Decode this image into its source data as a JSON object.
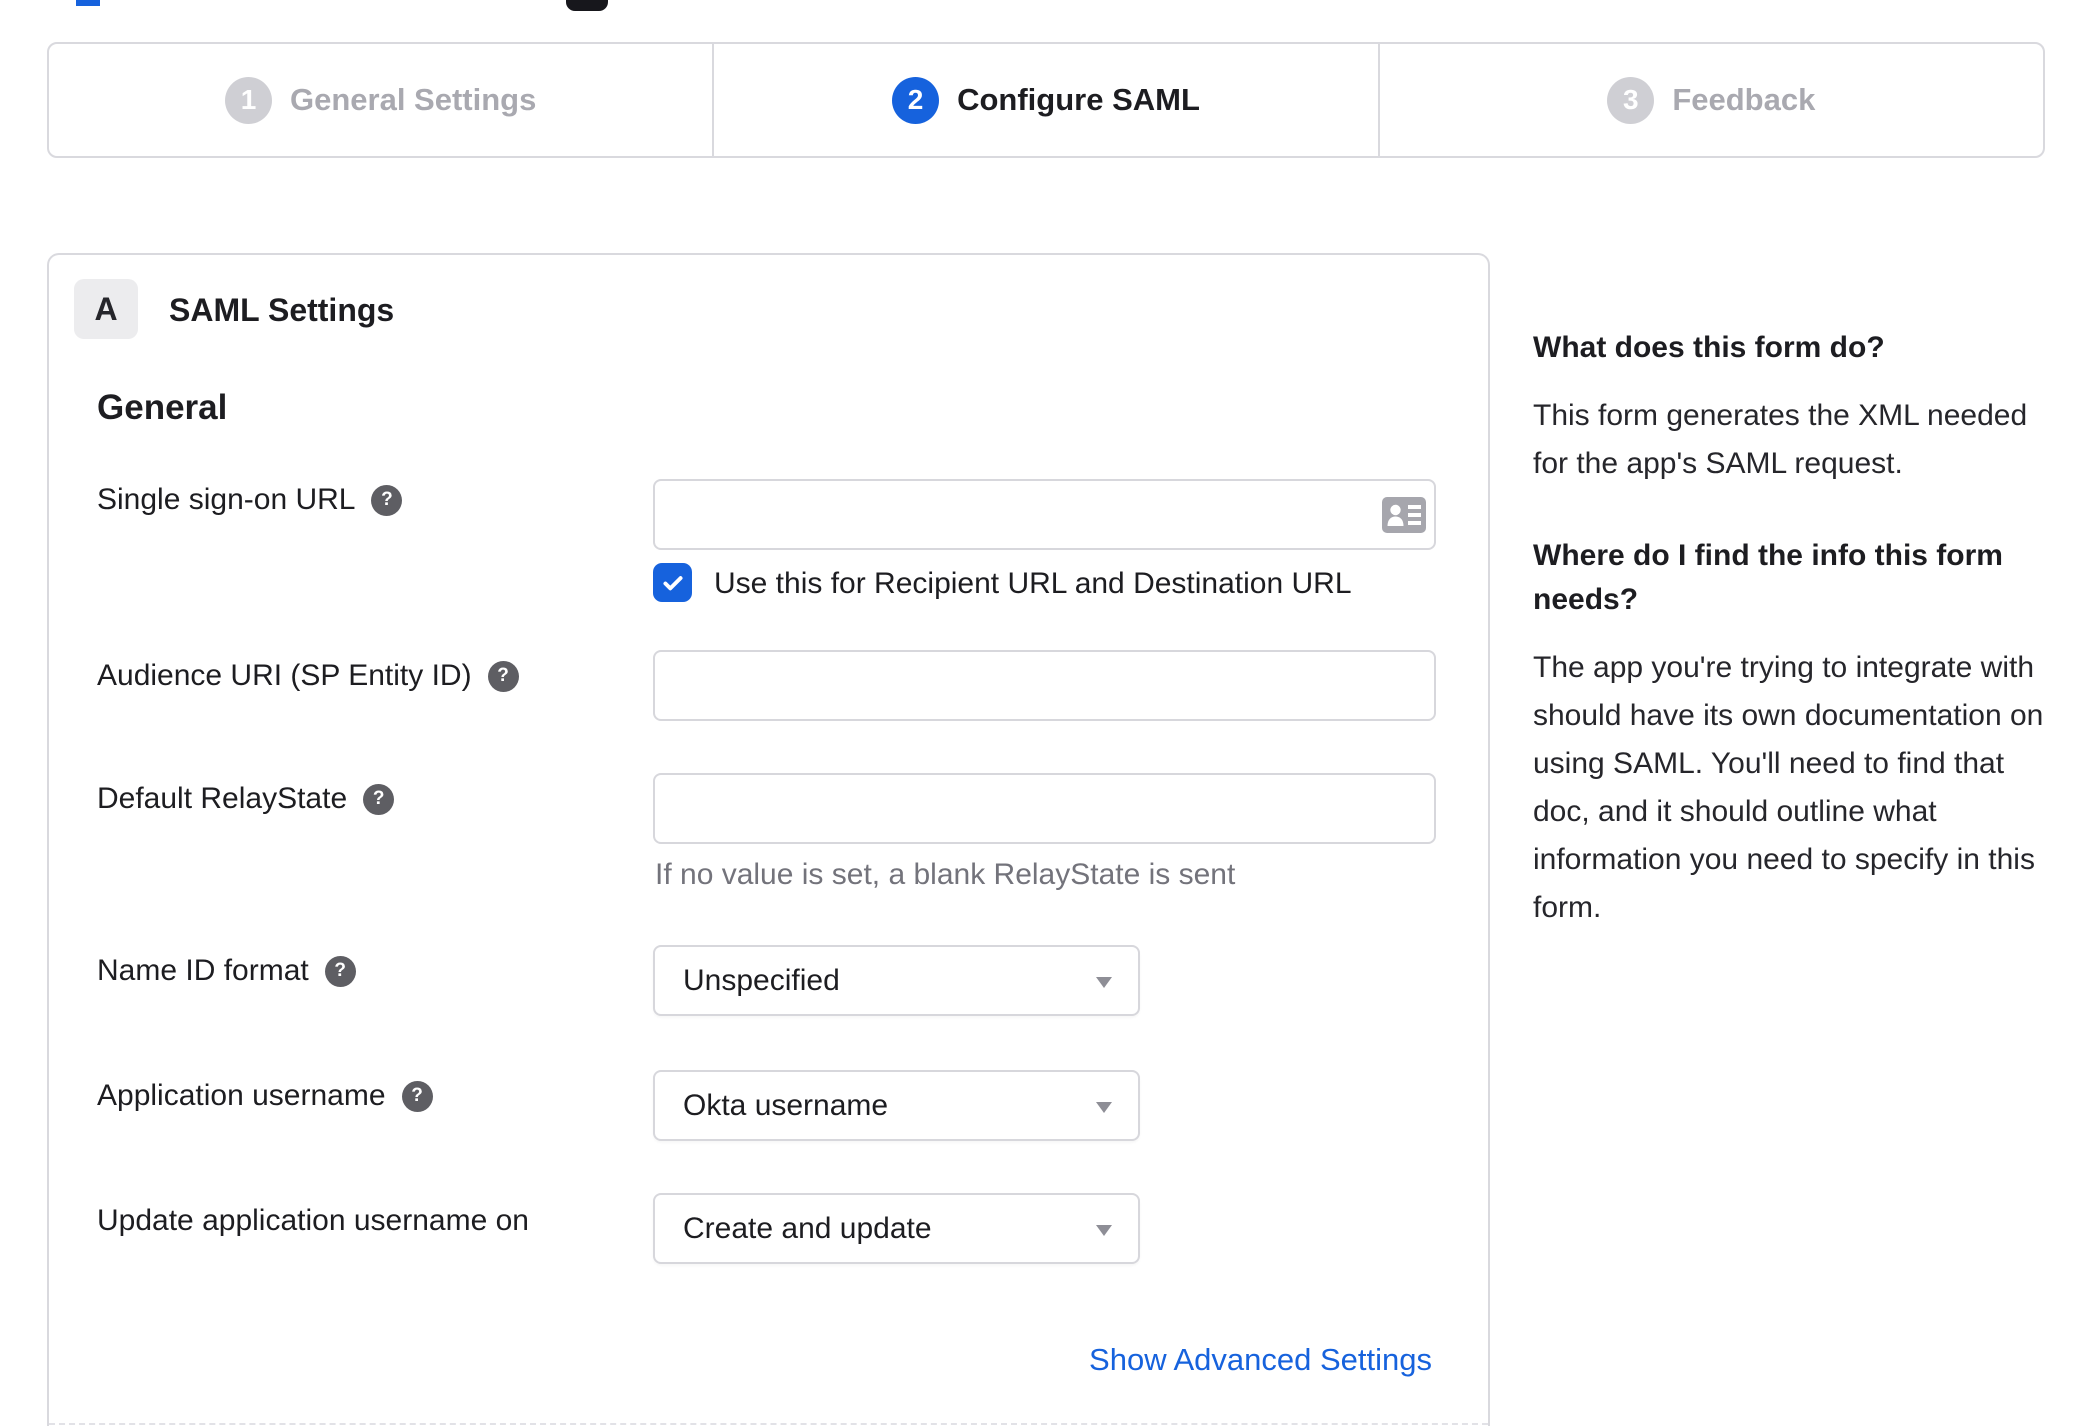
{
  "colors": {
    "accent": "#1662dd",
    "border": "#d9d9de",
    "text": "#1d1d21",
    "muted_label": "#a9a9b0",
    "hint": "#73737b"
  },
  "stepper": {
    "steps": [
      {
        "number": "1",
        "label": "General Settings",
        "state": "inactive"
      },
      {
        "number": "2",
        "label": "Configure SAML",
        "state": "active"
      },
      {
        "number": "3",
        "label": "Feedback",
        "state": "inactive"
      }
    ]
  },
  "panel": {
    "section_badge": "A",
    "section_title": "SAML Settings",
    "group_heading": "General",
    "fields": [
      {
        "label": "Single sign-on URL",
        "has_help": true,
        "type": "text",
        "value": "",
        "checkbox": {
          "checked": true,
          "label": "Use this for Recipient URL and Destination URL"
        }
      },
      {
        "label": "Audience URI (SP Entity ID)",
        "has_help": true,
        "type": "text",
        "value": ""
      },
      {
        "label": "Default RelayState",
        "has_help": true,
        "type": "text",
        "value": "",
        "hint": "If no value is set, a blank RelayState is sent"
      },
      {
        "label": "Name ID format",
        "has_help": true,
        "type": "select",
        "value": "Unspecified"
      },
      {
        "label": "Application username",
        "has_help": true,
        "type": "select",
        "value": "Okta username"
      },
      {
        "label": "Update application username on",
        "has_help": false,
        "type": "select",
        "value": "Create and update"
      }
    ],
    "advanced_link": "Show Advanced Settings",
    "help_icon_glyph": "?"
  },
  "sidebar": {
    "sections": [
      {
        "heading": "What does this form do?",
        "body": "This form generates the XML needed for the app's SAML request."
      },
      {
        "heading": "Where do I find the info this form needs?",
        "body": "The app you're trying to integrate with should have its own documentation on using SAML. You'll need to find that doc, and it should outline what information you need to specify in this form."
      }
    ]
  }
}
